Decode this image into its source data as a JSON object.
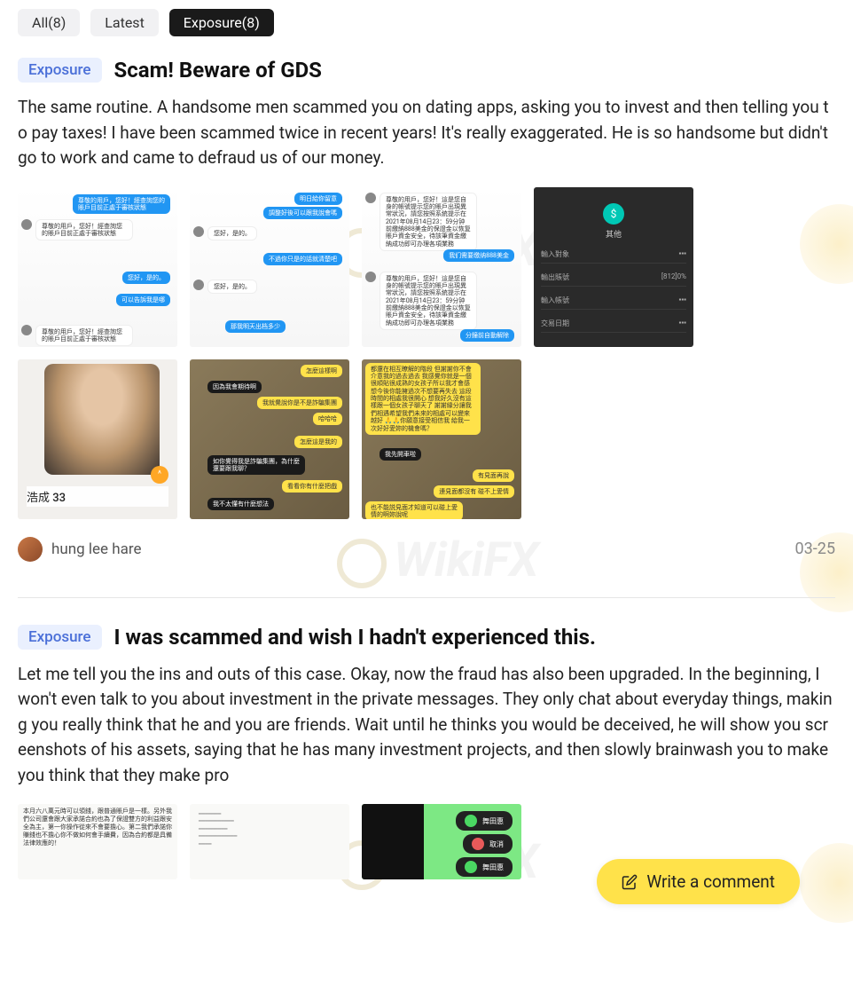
{
  "tabs": {
    "all": "All(8)",
    "latest": "Latest",
    "exposure": "Exposure(8)"
  },
  "posts": [
    {
      "badge": "Exposure",
      "title": "Scam! Beware of GDS",
      "body": "The same routine. A handsome men scammed you on dating apps, asking you to invest and then telling you to pay taxes! I have been scammed twice in recent years! It's really exaggerated. He is so handsome but didn't go to work and came to defraud us of our money.",
      "author": "hung lee hare",
      "date": "03-25",
      "thumbs": {
        "chat1_b1": "尊敬的用戶，您好！經查詢您的賬戶目前正處于審核狀態",
        "chat1_b2": "您好，是的。",
        "chat1_b3": "可以告訴我是哪",
        "chat2_b1": "明日給你留意",
        "chat2_b2": "調整好後可以跟我說會嗎",
        "chat2_b3": "您好，是的。",
        "chat2_b4": "不過你只是的話就清楚吧",
        "chat2_b5": "您好，是的。",
        "chat2_b6": "那我明天出档多少",
        "chat3_b1": "尊敬的用戶，您好！這是您自身的帳號提示您的賬戶出現異常狀況，請您按照系統提示在2021年08月14日23：59分钟前繳納888美金的保證金以恢复賬戶資金安全，待該筆資金繳納成功即可办理各項業務",
        "chat3_b2": "我们需要缴纳888美金",
        "chat3_b3": "分鐘前自動解除",
        "dark_label": "其他",
        "dark_r1_l": "輸入對象",
        "dark_r2_l": "輸出賬號",
        "dark_r2_r": "[812]0%",
        "dark_r3_l": "輸入帳號",
        "dark_r4_l": "交易日期",
        "photo_caption": "浩成 33",
        "cat1_b1": "怎麼這樣啊",
        "cat1_b2": "因為我會期待啊",
        "cat1_b3": "我就覺說你是不是詐騙集團",
        "cat1_b4": "哈哈哈",
        "cat1_b5": "怎麼這是我的",
        "cat1_b6": "如你覺得我是詐騙集團，為什麼還要跟我聊？",
        "cat1_b7": "看看你有什麼把戲",
        "cat1_b8": "我不太懂有什麼想法",
        "cat2_b1": "都還在相互瞭解的階段 但謝謝你不會介意我的過去過去 我感覺你就是一個很順貼很成熟的女孩子所以我才會感想今後你能擁過次不想要再失去 這段時間的相處我很開心 想我好久沒有這樣跟一個女孩子聊天了 謝謝緣分讓我們相遇希望我們未來的相處可以變來越好 🙏🙏你願意接受相信我 給我一次好好愛妳的機會嗎？",
        "cat2_b2": "我先開車啦",
        "cat2_b3": "有見面再說",
        "cat2_b4": "連見面都沒有 碰不上愛情",
        "cat2_b5": "也不能説見面才知道可以碰上愛情的啊妳說呢"
      }
    },
    {
      "badge": "Exposure",
      "title": "I was scammed and wish I hadn't experienced this.",
      "body": "Let me tell you the ins and outs of this case. Okay, now the fraud has also been upgraded. In the beginning, I won't even talk to you about investment in the private messages. They only chat about everyday things, making you really think that he and you are friends. Wait until he thinks you would be deceived, he will show you screenshots of his assets, saying that he has many investment projects, and then slowly brainwash you to make you think that they make pro",
      "thumbs": {
        "doc1": "本月六八萬元時可以領錢，跟普通賬戶是一樣。另外我們公司還會跟大家承諾合約也為了保證雙方的利益跟安全為主，第一你操作從來不會要擔心。第二我們承諾你賺錢也不擔心你不做如何會手續費，因為合約都是具備法律效應的！",
        "green_b1": "舞田惠",
        "green_b2": "取消",
        "green_b3": "舞田惠"
      }
    }
  ],
  "watermark": "WikiFX",
  "writeComment": "Write a comment"
}
